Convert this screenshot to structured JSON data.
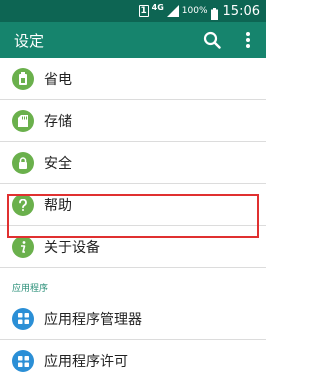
{
  "status_bar": {
    "sim_slot": "1",
    "network_type": "4G",
    "battery_percent": "100%",
    "time": "15:06"
  },
  "app_bar": {
    "title": "设定",
    "search_icon": "search-icon",
    "more_icon": "more-vert-icon"
  },
  "settings_items": [
    {
      "label": "省电",
      "icon": "battery-icon"
    },
    {
      "label": "存储",
      "icon": "sd-card-icon"
    },
    {
      "label": "安全",
      "icon": "lock-icon"
    },
    {
      "label": "帮助",
      "icon": "help-icon"
    },
    {
      "label": "关于设备",
      "icon": "info-icon"
    }
  ],
  "section": {
    "header": "应用程序",
    "items": [
      {
        "label": "应用程序管理器",
        "icon": "app-grid-icon"
      },
      {
        "label": "应用程序许可",
        "icon": "app-grid-icon"
      }
    ]
  },
  "colors": {
    "status_bar": "#0d6553",
    "app_bar": "#16846d",
    "icon_green": "#6ab04c",
    "icon_blue": "#2b8fd6",
    "highlight": "#e03030",
    "section_text": "#2a8f78"
  }
}
